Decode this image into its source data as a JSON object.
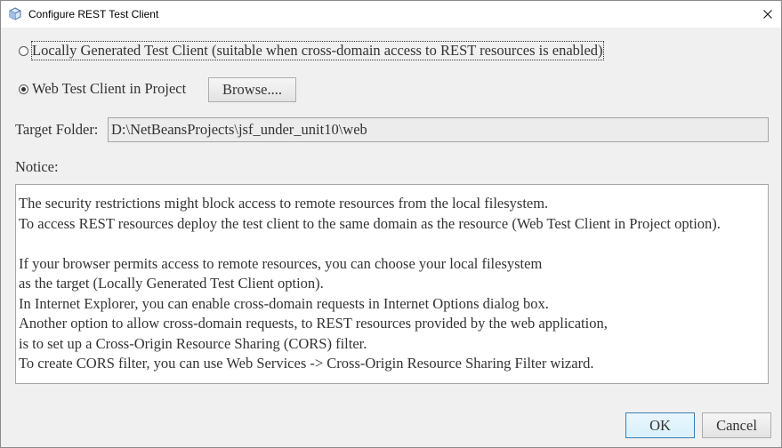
{
  "window": {
    "title": "Configure REST Test Client"
  },
  "options": {
    "local": {
      "label": "Locally Generated Test Client (suitable when cross-domain access to REST resources is enabled)",
      "selected": false
    },
    "web": {
      "label": "Web Test Client in Project",
      "selected": true
    },
    "browse_label": "Browse...."
  },
  "target": {
    "label": "Target Folder:",
    "value": "D:\\NetBeansProjects\\jsf_under_unit10\\web"
  },
  "notice": {
    "label": "Notice:",
    "lines": [
      "The security restrictions might block access to remote resources from the local filesystem.",
      "To access REST resources deploy the test client to the same domain as the resource (Web Test Client in Project option).",
      "",
      "If your browser permits access to remote resources, you can choose your local filesystem",
      "as the target (Locally Generated Test Client option).",
      "In Internet Explorer, you can enable cross-domain requests in Internet Options dialog box.",
      "Another option to allow cross-domain requests, to REST resources provided by the web application,",
      "is to set up a Cross-Origin Resource Sharing (CORS) filter.",
      "To create CORS filter, you can use Web Services -> Cross-Origin Resource Sharing Filter wizard."
    ]
  },
  "buttons": {
    "ok": "OK",
    "cancel": "Cancel"
  },
  "icons": {
    "app": "netbeans-cube-icon",
    "close": "close-icon"
  }
}
